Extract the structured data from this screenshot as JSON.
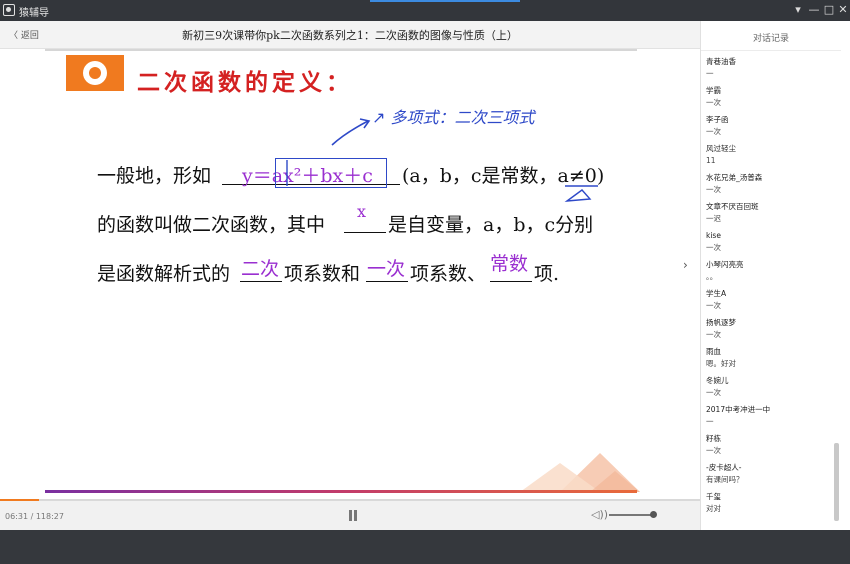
{
  "window": {
    "app_name": "猿辅导",
    "controls": [
      "▾",
      "—",
      "□",
      "✕"
    ]
  },
  "lesson": {
    "back_label": "〈 返回",
    "title": "新初三9次课带你pk二次函数系列之1：二次函数的图像与性质（上）"
  },
  "slide": {
    "heading": "二次函数的定义：",
    "handwritten_note": "↗ 多项式：二次三项式",
    "line1_prefix": "一般地，形如",
    "line1_fill": "y＝ax²＋bx＋c",
    "line1_suffix": "(a，b，c是常数，a≠0)",
    "line2_prefix": "的函数叫做二次函数，其中",
    "line2_fill": "x",
    "line2_suffix": "是自变量，a，b，c分别",
    "line3_prefix": "是函数解析式的",
    "line3_fill1": "二次",
    "line3_mid1": "项系数和",
    "line3_fill2": "一次",
    "line3_mid2": "项系数、",
    "line3_fill3": "常数",
    "line3_suffix": "项."
  },
  "player": {
    "time": "06:31 / 118:27",
    "progress_fraction": 0.055,
    "volume_fraction": 0.9,
    "volume_icon": "speaker-icon",
    "pause_icon": "pause-icon"
  },
  "chat": {
    "title": "对话记录",
    "messages": [
      {
        "user": "青巷油香",
        "text": "一"
      },
      {
        "user": "学霸",
        "text": "一次"
      },
      {
        "user": "李子函",
        "text": "一次"
      },
      {
        "user": "风过轻尘",
        "text": "11"
      },
      {
        "user": "水花兄弟_汤普森",
        "text": "一次"
      },
      {
        "user": "文章不厌百回斑",
        "text": "一迟"
      },
      {
        "user": "kise",
        "text": "一次"
      },
      {
        "user": "小琴闪亮亮",
        "text": "。。"
      },
      {
        "user": "学生A",
        "text": "一次"
      },
      {
        "user": "扬帆逐梦",
        "text": "一次"
      },
      {
        "user": "雨血",
        "text": "嗯。好对"
      },
      {
        "user": "冬婉儿",
        "text": "一次"
      },
      {
        "user": "2017中考冲进一中",
        "text": "一"
      },
      {
        "user": "籽栋",
        "text": "一次"
      },
      {
        "user": "-皮卡超人-",
        "text": "有课间吗？"
      },
      {
        "user": "千玺",
        "text": "对对"
      }
    ]
  },
  "colors": {
    "accent_orange": "#f07a1f",
    "heading_red": "#d42121",
    "fill_purple": "#9a2fd0",
    "ink_blue": "#2e49c8"
  }
}
